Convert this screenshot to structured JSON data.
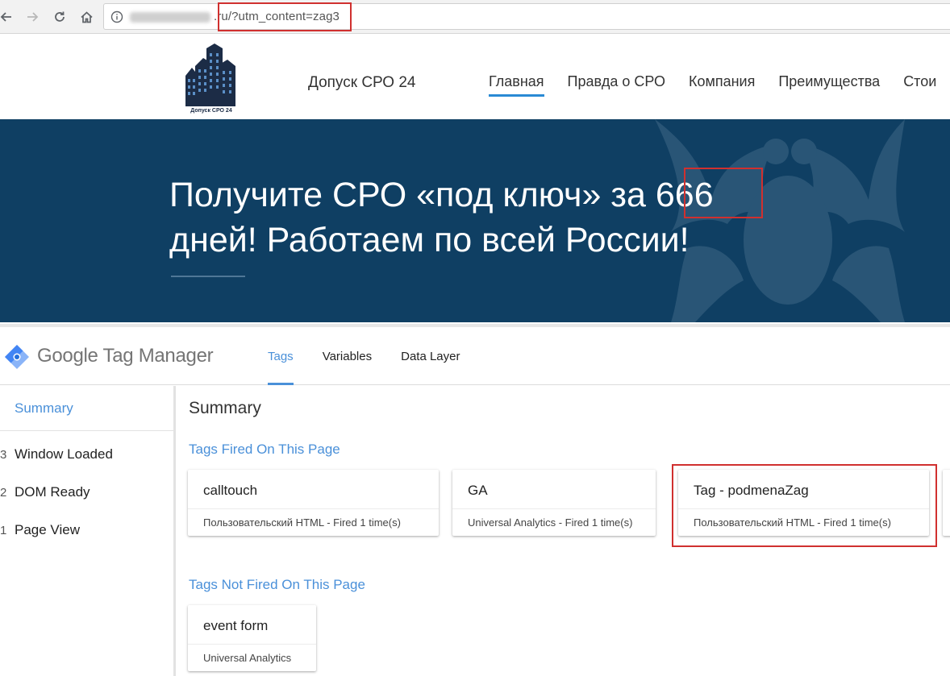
{
  "browser": {
    "url_host": ".ru",
    "url_query": "/?utm_content=zag3",
    "highlight_color": "#d0302f"
  },
  "site": {
    "logo_caption": "Допуск СРО 24",
    "name": "Допуск СРО 24",
    "nav": [
      "Главная",
      "Правда о СРО",
      "Компания",
      "Преимущества",
      "Стои"
    ],
    "active_nav": "Главная",
    "hero_line1_prefix": "Получите СРО «под ключ» за ",
    "hero_number": "666",
    "hero_line2": "дней! Работаем по всей России!",
    "hero_bg": "#0f3f63"
  },
  "gtm": {
    "brand": "Google Tag Manager",
    "tabs": [
      "Tags",
      "Variables",
      "Data Layer"
    ],
    "active_tab": "Tags",
    "sidebar": {
      "summary": "Summary",
      "events": [
        {
          "num": "3",
          "label": "Window Loaded"
        },
        {
          "num": "2",
          "label": "DOM Ready"
        },
        {
          "num": "1",
          "label": "Page View"
        }
      ]
    },
    "main_title": "Summary",
    "fired_title": "Tags Fired On This Page",
    "not_fired_title": "Tags Not Fired On This Page",
    "fired_tags": [
      {
        "name": "calltouch",
        "type": "Пользовательский HTML - Fired 1 time(s)"
      },
      {
        "name": "GA",
        "type": "Universal Analytics - Fired 1 time(s)"
      },
      {
        "name": "Tag - podmenaZag",
        "type": "Пользовательский HTML - Fired 1 time(s)"
      }
    ],
    "not_fired_tags": [
      {
        "name": "event form",
        "type": "Universal Analytics"
      }
    ],
    "accent_color": "#4a90d9"
  }
}
